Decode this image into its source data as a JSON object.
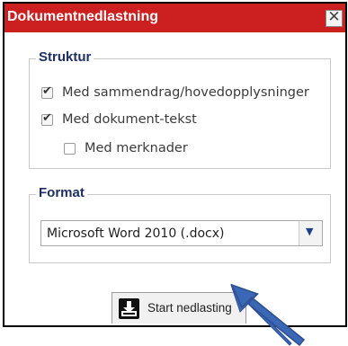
{
  "dialog": {
    "title": "Dokumentnedlastning",
    "close_icon": "close-icon"
  },
  "structure": {
    "legend": "Struktur",
    "options": [
      {
        "label": "Med sammendrag/hovedopplysninger",
        "checked": true
      },
      {
        "label": "Med dokument-tekst",
        "checked": true
      },
      {
        "label": "Med merknader",
        "checked": false
      }
    ]
  },
  "format": {
    "legend": "Format",
    "selected": "Microsoft Word 2010 (.docx)",
    "dropdown_icon": "chevron-down-icon"
  },
  "actions": {
    "start_label": "Start nedlasting",
    "start_icon": "download-icon"
  },
  "annotation": {
    "arrow_color": "#3a68b6",
    "arrow_icon": "arrow-icon"
  },
  "colors": {
    "titlebar": "#cc1f1f",
    "legend_text": "#1f2f63"
  }
}
